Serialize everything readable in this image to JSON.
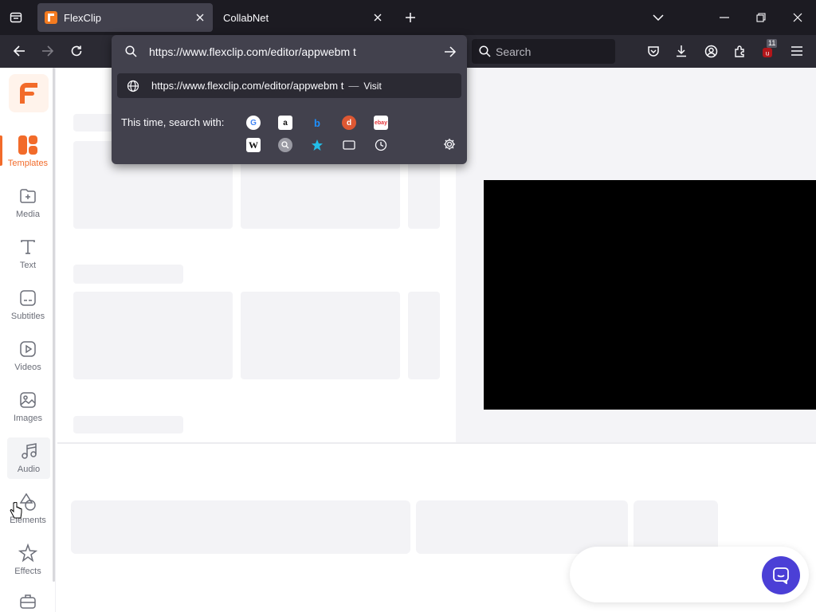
{
  "browser": {
    "tabs": [
      {
        "title": "FlexClip",
        "active": true,
        "icon": "flexclip-favicon"
      },
      {
        "title": "CollabNet",
        "active": false
      }
    ],
    "url_text": "https://www.flexclip.com/editor/appwebm t",
    "suggestion": {
      "url": "https://www.flexclip.com/editor/appwebm t",
      "separator": "—",
      "action": "Visit"
    },
    "search_placeholder": "Search",
    "one_off_label": "This time, search with:",
    "engines": [
      "google-icon",
      "amazon-icon",
      "bing-icon",
      "duckduckgo-icon",
      "ebay-icon",
      "wikipedia-icon",
      "search-engine-icon",
      "bookmarks-icon",
      "tabs-icon",
      "history-icon"
    ],
    "extension_badge": "11",
    "colors": {
      "chrome_dark": "#1c1b22",
      "toolbar": "#2b2a33",
      "panel": "#42414d"
    }
  },
  "sidebar": {
    "items": [
      {
        "label": "Templates",
        "icon": "templates-icon",
        "active": true
      },
      {
        "label": "Media",
        "icon": "media-icon"
      },
      {
        "label": "Text",
        "icon": "text-icon"
      },
      {
        "label": "Subtitles",
        "icon": "subtitles-icon"
      },
      {
        "label": "Videos",
        "icon": "videos-icon"
      },
      {
        "label": "Images",
        "icon": "images-icon"
      },
      {
        "label": "Audio",
        "icon": "audio-icon"
      },
      {
        "label": "Elements",
        "icon": "elements-icon"
      },
      {
        "label": "Effects",
        "icon": "effects-icon"
      }
    ],
    "accent": "#f26b2a"
  },
  "chat": {
    "icon": "chat-icon",
    "color": "#4b3fd6"
  }
}
